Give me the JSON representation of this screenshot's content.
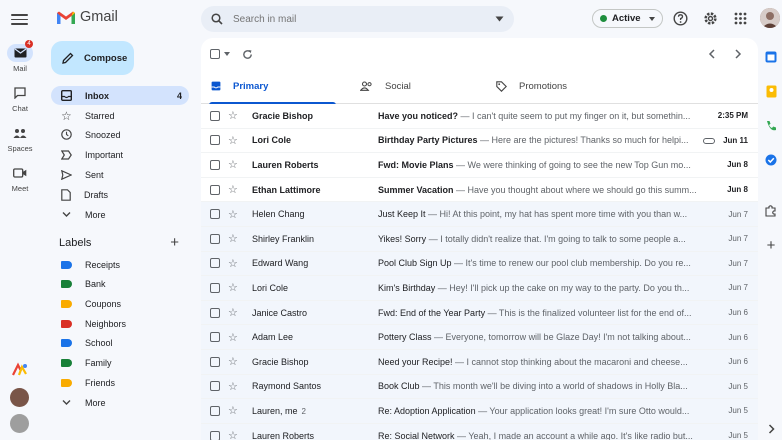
{
  "app": {
    "name": "Gmail"
  },
  "rail": [
    {
      "label": "Mail",
      "badge": "4"
    },
    {
      "label": "Chat"
    },
    {
      "label": "Spaces"
    },
    {
      "label": "Meet"
    }
  ],
  "search": {
    "placeholder": "Search in mail"
  },
  "status": {
    "label": "Active",
    "color": "#1e8e3e"
  },
  "compose": {
    "label": "Compose"
  },
  "nav": [
    {
      "label": "Inbox",
      "count": "4",
      "icon": "inbox-icon"
    },
    {
      "label": "Starred",
      "icon": "star-icon"
    },
    {
      "label": "Snoozed",
      "icon": "clock-icon"
    },
    {
      "label": "Important",
      "icon": "important-icon"
    },
    {
      "label": "Sent",
      "icon": "send-icon"
    },
    {
      "label": "Drafts",
      "icon": "draft-icon"
    },
    {
      "label": "More",
      "icon": "chevron-down-icon"
    }
  ],
  "labels": {
    "title": "Labels",
    "items": [
      {
        "label": "Receipts",
        "color": "#1a73e8"
      },
      {
        "label": "Bank",
        "color": "#188038"
      },
      {
        "label": "Coupons",
        "color": "#f9ab00"
      },
      {
        "label": "Neighbors",
        "color": "#d93025"
      },
      {
        "label": "School",
        "color": "#1a73e8"
      },
      {
        "label": "Family",
        "color": "#188038"
      },
      {
        "label": "Friends",
        "color": "#f9ab00"
      }
    ],
    "more": "More"
  },
  "tabs": [
    {
      "label": "Primary"
    },
    {
      "label": "Social"
    },
    {
      "label": "Promotions"
    }
  ],
  "emails": [
    {
      "sender": "Gracie Bishop",
      "subject": "Have you noticed?",
      "snippet": " — I can't quite seem to put my finger on it, but somethin...",
      "date": "2:35 PM",
      "unread": true
    },
    {
      "sender": "Lori Cole",
      "subject": "Birthday Party Pictures",
      "snippet": " — Here are the pictures! Thanks so much for helpi...",
      "date": "Jun 11",
      "unread": true,
      "attachment": true
    },
    {
      "sender": "Lauren Roberts",
      "subject": "Fwd: Movie Plans",
      "snippet": " — We were thinking of going to see the new Top Gun mo...",
      "date": "Jun 8",
      "unread": true
    },
    {
      "sender": "Ethan Lattimore",
      "subject": "Summer Vacation",
      "snippet": " — Have you thought about where we should go this summ...",
      "date": "Jun 8",
      "unread": true
    },
    {
      "sender": "Helen Chang",
      "subject": "Just Keep It",
      "snippet": " — Hi! At this point, my hat has spent more time with you than w...",
      "date": "Jun 7",
      "unread": false
    },
    {
      "sender": "Shirley Franklin",
      "subject": "Yikes! Sorry",
      "snippet": " — I totally didn't realize that. I'm going to talk to some people a...",
      "date": "Jun 7",
      "unread": false
    },
    {
      "sender": "Edward Wang",
      "subject": "Pool Club Sign Up",
      "snippet": " — It's time to renew our pool club membership. Do you re...",
      "date": "Jun 7",
      "unread": false
    },
    {
      "sender": "Lori Cole",
      "subject": "Kim's Birthday",
      "snippet": " — Hey! I'll pick up the cake on my way to the party. Do you th...",
      "date": "Jun 7",
      "unread": false
    },
    {
      "sender": "Janice Castro",
      "subject": "Fwd: End of the Year Party",
      "snippet": " — This is the finalized volunteer list for the end of...",
      "date": "Jun 6",
      "unread": false
    },
    {
      "sender": "Adam Lee",
      "subject": "Pottery Class",
      "snippet": " — Everyone, tomorrow will be Glaze Day! I'm not talking about...",
      "date": "Jun 6",
      "unread": false
    },
    {
      "sender": "Gracie Bishop",
      "subject": "Need your Recipe!",
      "snippet": " — I cannot stop thinking about the macaroni and cheese...",
      "date": "Jun 6",
      "unread": false
    },
    {
      "sender": "Raymond Santos",
      "subject": "Book Club",
      "snippet": " — This month we'll be diving into a world of shadows in Holly Bla...",
      "date": "Jun 5",
      "unread": false
    },
    {
      "sender": "Lauren, me",
      "count": "2",
      "subject": "Re: Adoption Application",
      "snippet": " — Your application looks great! I'm sure Otto would...",
      "date": "Jun 5",
      "unread": false
    },
    {
      "sender": "Lauren Roberts",
      "subject": "Re: Social Network",
      "snippet": " — Yeah, I made an account a while ago. It's like radio but...",
      "date": "Jun 5",
      "unread": false
    }
  ]
}
